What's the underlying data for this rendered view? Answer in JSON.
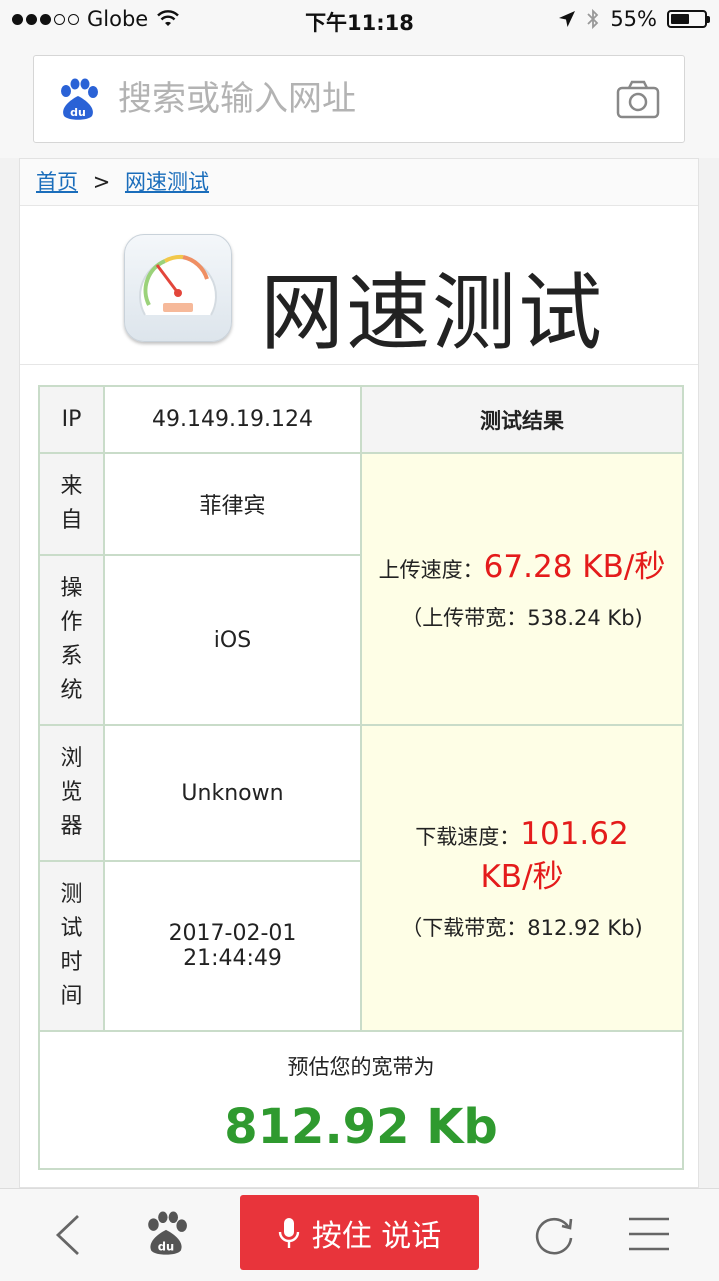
{
  "status_bar": {
    "carrier": "Globe",
    "time": "下午11:18",
    "battery": "55%",
    "battery_level": 0.55
  },
  "browser": {
    "search_placeholder": "搜索或输入网址"
  },
  "breadcrumb": {
    "home": "首页",
    "separator": ">",
    "current": "网速测试"
  },
  "page": {
    "title": "网速测试"
  },
  "table": {
    "ip_label": "IP",
    "ip_value": "49.149.19.124",
    "result_header": "测试结果",
    "from_label": "来自",
    "from_value": "菲律宾",
    "os_label": "操作系统",
    "os_value": "iOS",
    "browser_label": "浏览器",
    "browser_value": "Unknown",
    "time_label": "测试时间",
    "time_date": "2017-02-01",
    "time_clock": "21:44:49",
    "upload_label": "上传速度：",
    "upload_speed": "67.28 KB/秒",
    "upload_bandwidth": "（上传带宽：538.24 Kb)",
    "download_label": "下载速度：",
    "download_speed": "101.62 KB/秒",
    "download_bandwidth": "（下载带宽：812.92 Kb)",
    "estimate_label": "预估您的宽带为",
    "estimate_value": "812.92 Kb"
  },
  "toolbar": {
    "voice_button": "按住 说话"
  },
  "colors": {
    "link": "#1a6dbb",
    "speed_red": "#e41b1b",
    "estimate_green": "#2f9a2f",
    "result_bg": "#fefee6",
    "voice_button": "#e8343b"
  },
  "icons": [
    "wifi-icon",
    "location-arrow-icon",
    "bluetooth-icon",
    "battery-icon",
    "baidu-paw-icon",
    "camera-icon",
    "speedometer-icon",
    "back-icon",
    "microphone-icon",
    "refresh-icon",
    "menu-icon"
  ]
}
